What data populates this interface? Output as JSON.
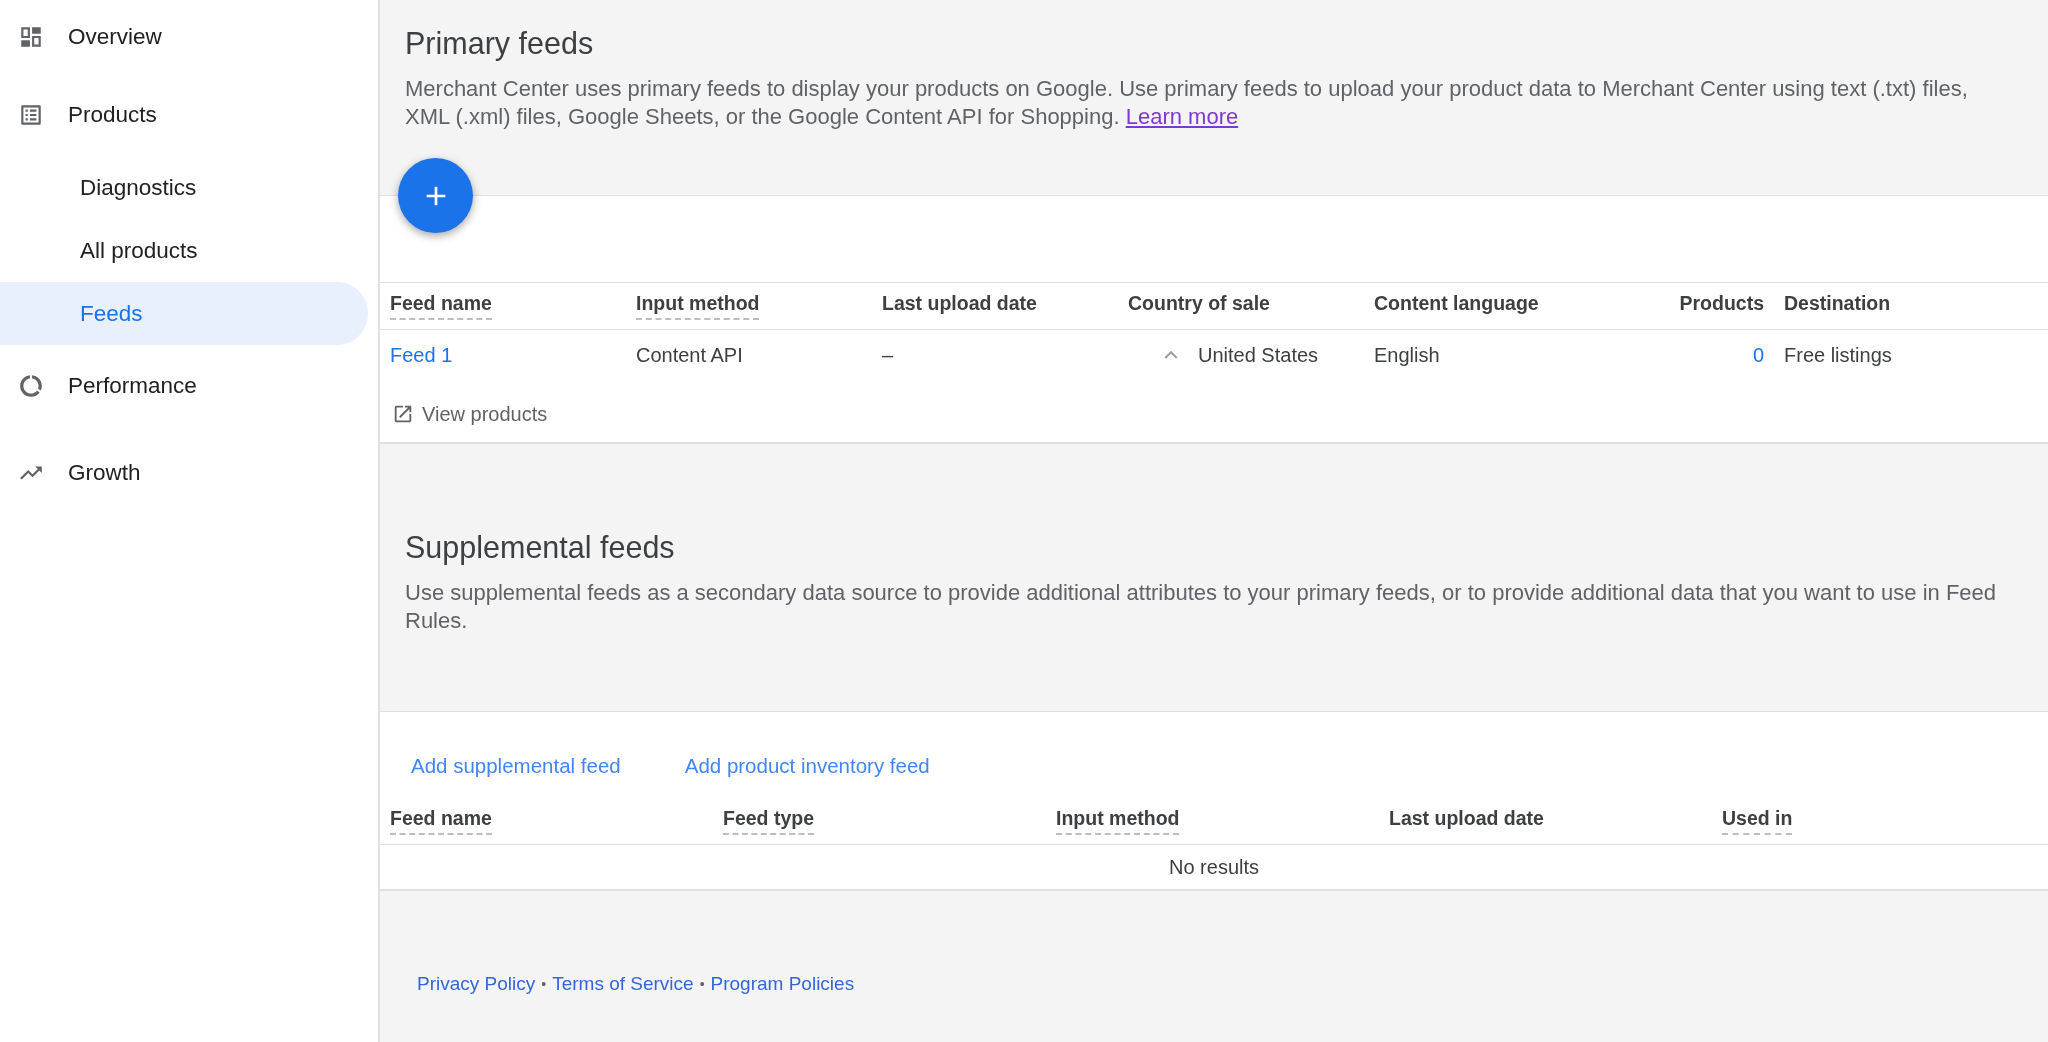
{
  "sidebar": {
    "items": [
      {
        "kind": "section",
        "label": "Overview",
        "selected": false
      },
      {
        "kind": "section",
        "label": "Products",
        "selected": false
      },
      {
        "kind": "sub",
        "label": "Diagnostics",
        "selected": false
      },
      {
        "kind": "sub",
        "label": "All products",
        "selected": false
      },
      {
        "kind": "sub",
        "label": "Feeds",
        "selected": true
      },
      {
        "kind": "section",
        "label": "Performance",
        "selected": false
      },
      {
        "kind": "section",
        "label": "Growth",
        "selected": false
      }
    ]
  },
  "primary": {
    "title": "Primary feeds",
    "description": "Merchant Center uses primary feeds to display your products on Google. Use primary feeds to upload your product data to Merchant Center using text (.txt) files, XML (.xml) files, Google Sheets, or the Google Content API for Shopping.",
    "link": "Learn more",
    "table": {
      "columns": [
        {
          "label": "Feed name",
          "dashed": true,
          "right_aligned": false
        },
        {
          "label": "Input method",
          "dashed": true,
          "right_aligned": false
        },
        {
          "label": "Last upload date",
          "dashed": false,
          "right_aligned": false
        },
        {
          "label": "Country of sale",
          "dashed": false,
          "right_aligned": false
        },
        {
          "label": "Content language",
          "dashed": false,
          "right_aligned": false
        },
        {
          "label": "Products",
          "dashed": false,
          "right_aligned": true
        },
        {
          "label": "Destination",
          "dashed": false,
          "right_aligned": false
        }
      ],
      "rows": [
        {
          "feed_name": "Feed 1",
          "input_method": "Content API",
          "last_upload": "–",
          "country": "United States",
          "expanded": true,
          "language": "English",
          "products": "0",
          "destination": "Free listings",
          "action": "View products"
        }
      ]
    }
  },
  "supplemental": {
    "title": "Supplemental feeds",
    "description": "Use supplemental feeds as a secondary data source to provide additional attributes to your primary feeds, or to provide additional data that you want to use in Feed Rules.",
    "actions": [
      "Add supplemental feed",
      "Add product inventory feed"
    ],
    "table": {
      "columns": [
        {
          "label": "Feed name",
          "dashed": true,
          "right_aligned": false
        },
        {
          "label": "Feed type",
          "dashed": true,
          "right_aligned": false
        },
        {
          "label": "Input method",
          "dashed": true,
          "right_aligned": false
        },
        {
          "label": "Last upload date",
          "dashed": false,
          "right_aligned": false
        },
        {
          "label": "Used in",
          "dashed": true,
          "right_aligned": false
        }
      ],
      "empty": "No results"
    }
  },
  "footer": {
    "links": [
      "Privacy Policy",
      "Terms of Service",
      "Program Policies"
    ],
    "separator": "•"
  }
}
